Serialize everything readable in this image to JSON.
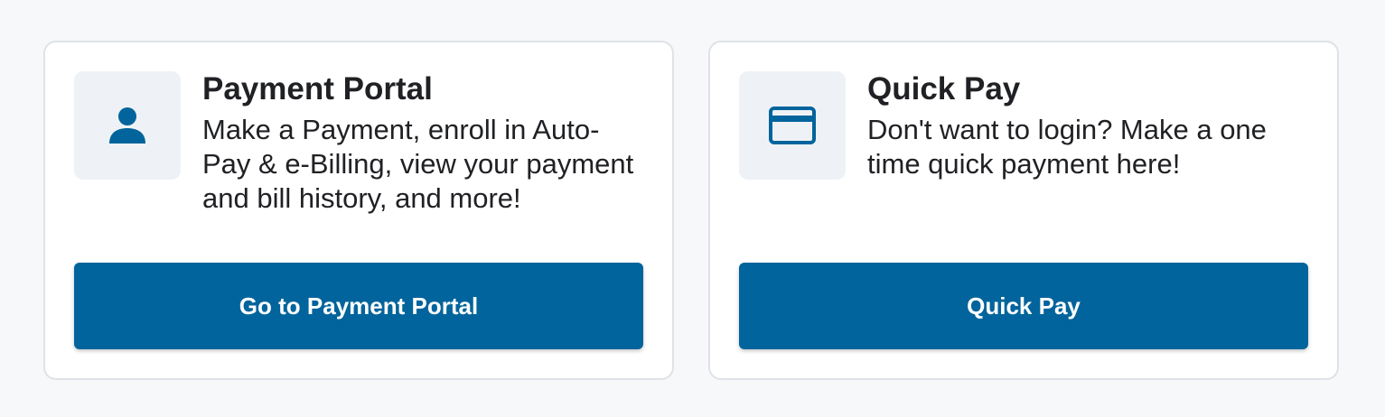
{
  "cards": [
    {
      "icon": "person-icon",
      "title": "Payment Portal",
      "description": "Make a Payment, enroll in Auto-Pay & e-Billing, view your payment and bill history, and more!",
      "button_label": "Go to Payment Portal"
    },
    {
      "icon": "credit-card-icon",
      "title": "Quick Pay",
      "description": "Don't want to login? Make a one time quick payment here!",
      "button_label": "Quick Pay"
    }
  ],
  "colors": {
    "accent": "#02649c",
    "icon_tile_bg": "#eef2f6",
    "card_border": "#dfe2e6",
    "page_bg": "#f7f8fa"
  }
}
